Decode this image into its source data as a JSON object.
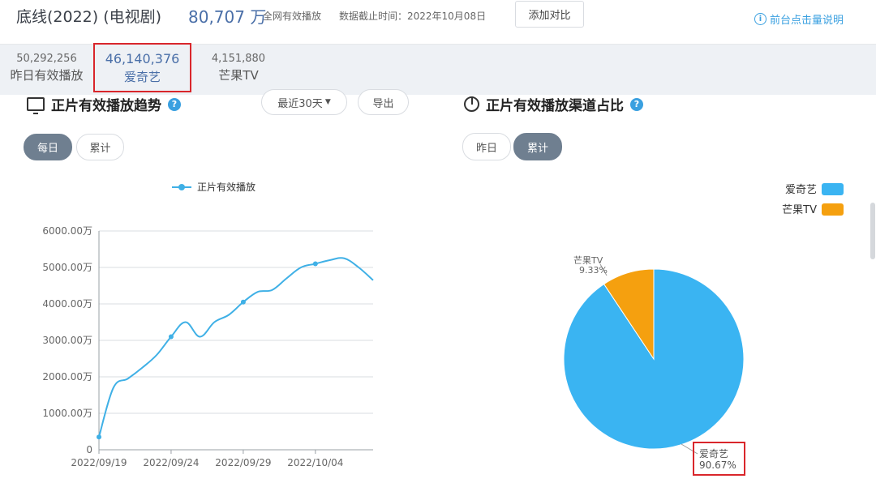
{
  "header": {
    "title": "底线(2022) (电视剧)",
    "total_plays": "80,707 万",
    "total_label": "全网有效播放",
    "as_of": "数据截止时间：2022年10月08日",
    "compare_button": "添加对比",
    "help_link": "前台点击量说明",
    "help_icon": "i"
  },
  "stats": [
    {
      "value": "50,292,256",
      "label": "昨日有效播放"
    },
    {
      "value": "46,140,376",
      "label": "爱奇艺"
    },
    {
      "value": "4,151,880",
      "label": "芒果TV"
    }
  ],
  "trend_panel": {
    "title": "正片有效播放趋势",
    "help_icon": "?",
    "range_select": "最近30天",
    "export_button": "导出",
    "toggles": [
      "每日",
      "累计"
    ],
    "active_toggle": "每日"
  },
  "share_panel": {
    "title": "正片有效播放渠道占比",
    "help_icon": "?",
    "toggles": [
      "昨日",
      "累计"
    ],
    "active_toggle": "累计"
  },
  "chart_data": [
    {
      "type": "line",
      "title": "",
      "legend_position": "top-center",
      "y_unit_suffix": "万",
      "ylim": [
        0,
        6000
      ],
      "yticks": [
        "0",
        "1000.00万",
        "2000.00万",
        "3000.00万",
        "4000.00万",
        "5000.00万",
        "6000.00万"
      ],
      "ytick_values": [
        0,
        1000,
        2000,
        3000,
        4000,
        5000,
        6000
      ],
      "x_tick_labels": [
        "2022/09/19",
        "2022/09/24",
        "2022/09/29",
        "2022/10/04"
      ],
      "grid": true,
      "categories": [
        "2022/09/19",
        "2022/09/20",
        "2022/09/21",
        "2022/09/22",
        "2022/09/23",
        "2022/09/24",
        "2022/09/25",
        "2022/09/26",
        "2022/09/27",
        "2022/09/28",
        "2022/09/29",
        "2022/09/30",
        "2022/10/01",
        "2022/10/02",
        "2022/10/03",
        "2022/10/04",
        "2022/10/05",
        "2022/10/06",
        "2022/10/07",
        "2022/10/08"
      ],
      "series": [
        {
          "name": "正片有效播放",
          "color": "#3fb0e6",
          "values": [
            350,
            1700,
            1950,
            2250,
            2600,
            3100,
            3500,
            3100,
            3500,
            3700,
            4050,
            4330,
            4380,
            4700,
            5000,
            5100,
            5200,
            5250,
            5000,
            4650
          ],
          "marked_indices": [
            0,
            5,
            10,
            15
          ]
        }
      ]
    },
    {
      "type": "pie",
      "title": "",
      "legend_position": "top-right",
      "slices": [
        {
          "label": "爱奇艺",
          "value": 90.67,
          "display": "90.67%",
          "color": "#3ab4f2"
        },
        {
          "label": "芒果TV",
          "value": 9.33,
          "display": "9.33%",
          "color": "#f5a00f"
        }
      ]
    }
  ]
}
